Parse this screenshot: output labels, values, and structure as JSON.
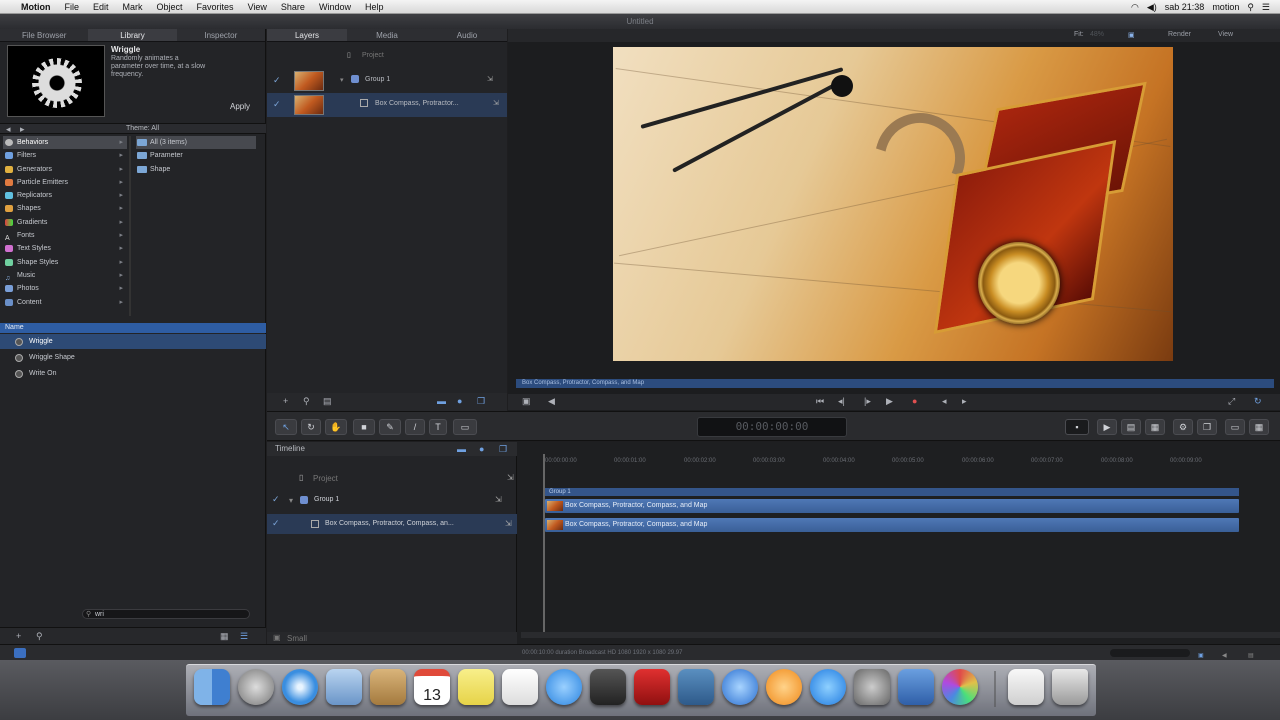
{
  "menubar": {
    "apple": "",
    "app_name": "Motion",
    "items": [
      "File",
      "Edit",
      "Mark",
      "Object",
      "Favorites",
      "View",
      "Share",
      "Window",
      "Help"
    ],
    "clock": "sab 21:38",
    "user": "motion"
  },
  "window": {
    "title": "Untitled"
  },
  "left_tabs": [
    "File Browser",
    "Library",
    "Inspector"
  ],
  "preview": {
    "title": "Wriggle",
    "description": "Randomly animates a parameter over time, at a slow frequency.",
    "apply_label": "Apply"
  },
  "browser": {
    "theme_label": "Theme: All"
  },
  "categories": [
    "Behaviors",
    "Filters",
    "Generators",
    "Particle Emitters",
    "Replicators",
    "Shapes",
    "Gradients",
    "Fonts",
    "Text Styles",
    "Shape Styles",
    "Music",
    "Photos",
    "Content"
  ],
  "subfolders": [
    "All (3 items)",
    "Parameter",
    "Shape"
  ],
  "name_header": "Name",
  "items": [
    "Wriggle",
    "Wriggle Shape",
    "Write On"
  ],
  "search": {
    "value": "wri"
  },
  "layer_tabs": [
    "Layers",
    "Media",
    "Audio"
  ],
  "layers": {
    "project": "Project",
    "group": "Group 1",
    "clip": "Box Compass, Protractor..."
  },
  "canvas_toolbar": {
    "fit_label": "Fit:",
    "fit_value": "48%",
    "render_label": "Render",
    "view_label": "View"
  },
  "canvas_timebar": "Box Compass, Protractor, Compass, and Map",
  "timecode": "00:00:00:00",
  "timeline": {
    "label": "Timeline",
    "project": "Project",
    "group": "Group 1",
    "clip_short": "Box Compass, Protractor, Compass, an...",
    "ruler": [
      "00:00:00:00",
      "00:00:01:00",
      "00:00:02:00",
      "00:00:03:00",
      "00:00:04:00",
      "00:00:05:00",
      "00:00:06:00",
      "00:00:07:00",
      "00:00:08:00",
      "00:00:09:00"
    ],
    "group_bar": "Group 1",
    "clips": [
      "Box Compass, Protractor, Compass, and Map",
      "Box Compass, Protractor, Compass, and Map"
    ],
    "size_label": "Small"
  },
  "status": "00:00:10:00 duration Broadcast HD 1080 1920 x 1080 29.97",
  "dock_icons": [
    "finder-icon",
    "launchpad-icon",
    "safari-icon",
    "mail-icon",
    "contacts-icon",
    "calendar-icon",
    "notes-icon",
    "reminders-icon",
    "messages-icon",
    "facetime-icon",
    "photo-booth-icon",
    "iphoto-icon",
    "itunes-icon",
    "ibooks-icon",
    "app-store-icon",
    "system-preferences-icon",
    "keynote-icon",
    "motion-icon",
    "downloads-icon",
    "trash-icon"
  ],
  "calendar_day": "13"
}
